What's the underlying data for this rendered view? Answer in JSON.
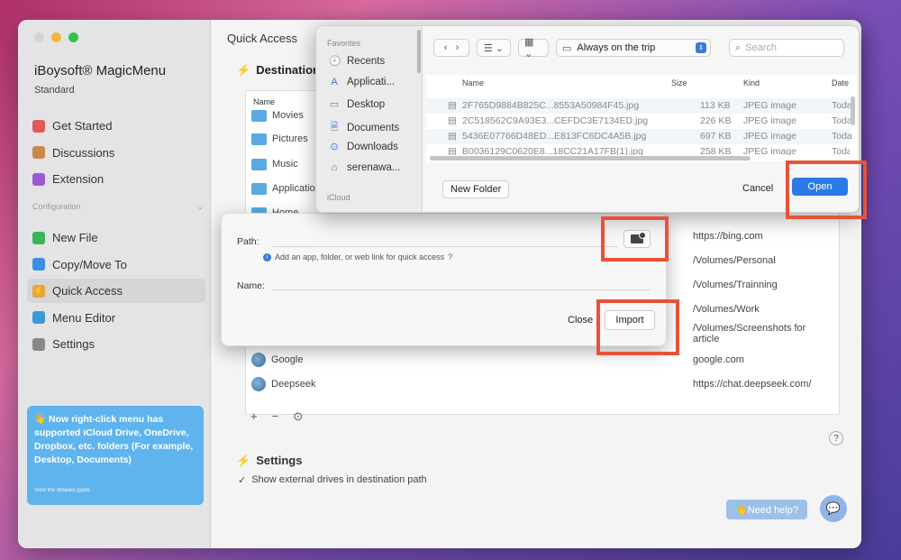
{
  "app": {
    "name": "iBoysoft® MagicMenu",
    "edition": "Standard",
    "nav_items": [
      {
        "label": "Get Started",
        "color": "#e05a5a"
      },
      {
        "label": "Discussions",
        "color": "#c9894a"
      },
      {
        "label": "Extension",
        "color": "#9b5bd6"
      }
    ],
    "config_label": "Configuration",
    "config_items": [
      {
        "label": "New File",
        "color": "#3db35a"
      },
      {
        "label": "Copy/Move To",
        "color": "#3a8fe0"
      },
      {
        "label": "Quick Access",
        "color": "#e8a53a",
        "active": true
      },
      {
        "label": "Menu Editor",
        "color": "#3a9ad9"
      },
      {
        "label": "Settings",
        "color": "#888888"
      }
    ],
    "promo_text": "👋 Now right-click menu has supported iCloud Drive, OneDrive, Dropbox, etc. folders (For example, Desktop, Documents)",
    "promo_link": "View the detailed guide"
  },
  "content": {
    "title": "Quick Access",
    "destination_heading": "Destination",
    "name_col": "Name",
    "rows": [
      {
        "name": "Movies",
        "path": "",
        "kind": "folder"
      },
      {
        "name": "Pictures",
        "path": "",
        "kind": "folder"
      },
      {
        "name": "Music",
        "path": "",
        "kind": "folder"
      },
      {
        "name": "Applications",
        "path": "",
        "kind": "folder"
      },
      {
        "name": "Home",
        "path": "",
        "kind": "folder"
      },
      {
        "name": "",
        "path": "https://bing.com",
        "kind": "folder"
      },
      {
        "name": "",
        "path": "/Volumes/Personal",
        "kind": "folder"
      },
      {
        "name": "",
        "path": "/Volumes/Trainning",
        "kind": "folder"
      },
      {
        "name": "",
        "path": "/Volumes/Work",
        "kind": "folder"
      },
      {
        "name": "",
        "path": "/Volumes/Screenshots for article",
        "kind": "folder"
      },
      {
        "name": "Google",
        "path": "google.com",
        "kind": "globe"
      },
      {
        "name": "Deepseek",
        "path": "https://chat.deepseek.com/",
        "kind": "globe"
      }
    ],
    "tools": [
      "+",
      "−",
      "⊙"
    ],
    "help_q": "?",
    "settings_heading": "Settings",
    "settings_item": "Show external drives in destination path",
    "need_help": "👋Need help?"
  },
  "file_sheet": {
    "favorites_label": "Favorites",
    "favorites": [
      {
        "label": "Recents",
        "icon": "🕘"
      },
      {
        "label": "Applicati...",
        "icon": "A"
      },
      {
        "label": "Desktop",
        "icon": "▭"
      },
      {
        "label": "Documents",
        "icon": "🗎"
      },
      {
        "label": "Downloads",
        "icon": "⊙"
      },
      {
        "label": "serenawa...",
        "icon": "⌂"
      }
    ],
    "icloud_label": "iCloud",
    "location": "Always on the trip",
    "search_placeholder": "Search",
    "columns": {
      "name": "Name",
      "size": "Size",
      "kind": "Kind",
      "date": "Date"
    },
    "files": [
      {
        "name": "2F765D9884B825C...8553A50984F45.jpg",
        "size": "113 KB",
        "kind": "JPEG image",
        "date": "Toda"
      },
      {
        "name": "2C518562C9A93E3...CEFDC3E7134ED.jpg",
        "size": "226 KB",
        "kind": "JPEG image",
        "date": "Toda"
      },
      {
        "name": "5436E07766D48ED...E813FC6DC4A5B.jpg",
        "size": "697 KB",
        "kind": "JPEG image",
        "date": "Toda"
      },
      {
        "name": "B0036129C0620E8...18CC21A17FB(1).jpg",
        "size": "258 KB",
        "kind": "JPEG image",
        "date": "Toda"
      }
    ],
    "new_folder": "New Folder",
    "cancel": "Cancel",
    "open": "Open"
  },
  "add_dialog": {
    "path_label": "Path:",
    "path_value": "",
    "hint": "Add an app, folder, or web link for quick access",
    "hint_q": "?",
    "name_label": "Name:",
    "name_value": "",
    "close": "Close",
    "import": "Import"
  },
  "highlight_color": "#e8523a"
}
